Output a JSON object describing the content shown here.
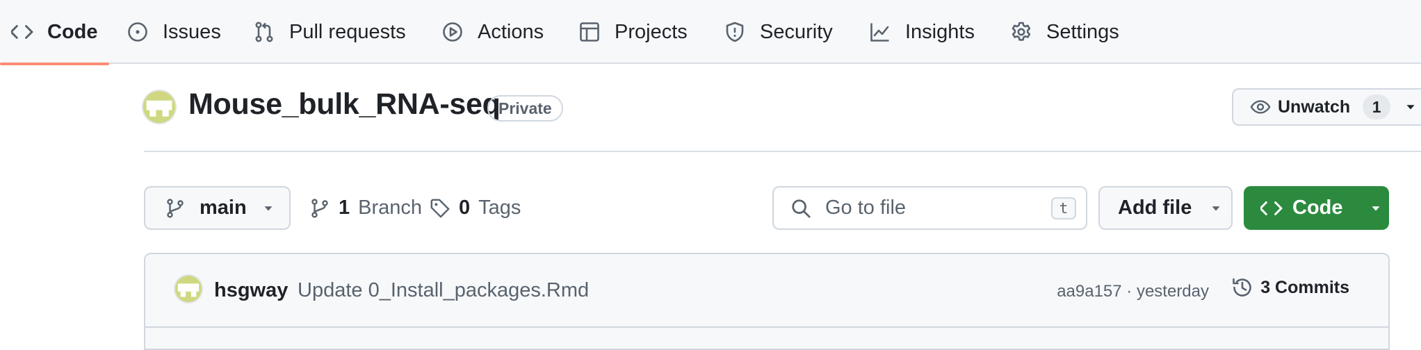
{
  "nav": {
    "tabs": [
      {
        "label": "Code",
        "icon": "code-icon",
        "active": true
      },
      {
        "label": "Issues",
        "icon": "issue-opened-icon"
      },
      {
        "label": "Pull requests",
        "icon": "git-pull-request-icon"
      },
      {
        "label": "Actions",
        "icon": "play-icon"
      },
      {
        "label": "Projects",
        "icon": "table-icon"
      },
      {
        "label": "Security",
        "icon": "shield-icon"
      },
      {
        "label": "Insights",
        "icon": "graph-icon"
      },
      {
        "label": "Settings",
        "icon": "gear-icon"
      }
    ]
  },
  "repo": {
    "name": "Mouse_bulk_RNA-seq",
    "visibility": "Private",
    "watch": {
      "label": "Unwatch",
      "count": "1"
    }
  },
  "files": {
    "branch": "main",
    "branches": {
      "count": "1",
      "label": "Branch"
    },
    "tags": {
      "count": "0",
      "label": "Tags"
    },
    "search_placeholder": "Go to file",
    "search_shortcut": "t",
    "add_file_label": "Add file",
    "code_label": "Code"
  },
  "latest_commit": {
    "author": "hsgway",
    "message": "Update 0_Install_packages.Rmd",
    "meta": "aa9a157 · yesterday",
    "commits_label": "3 Commits"
  },
  "colors": {
    "accent_underline": "#fd8c73",
    "primary_button": "#2c8a3e",
    "avatar": "#cfd880"
  }
}
